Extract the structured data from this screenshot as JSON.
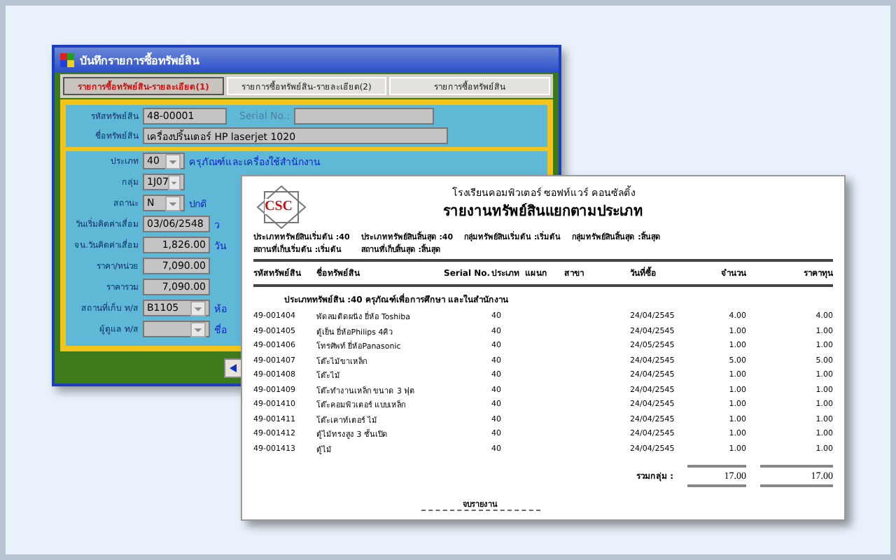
{
  "form": {
    "title": "บันทึกรายการซื้อทรัพย์สิน",
    "tabs": [
      {
        "label": "รายการซื้อทรัพย์สิน-รายละเอียด(1)",
        "selected": true
      },
      {
        "label": "รายการซื้อทรัพย์สิน-รายละเอียด(2)",
        "selected": false
      },
      {
        "label": "รายการซื้อทรัพย์สิน",
        "selected": false
      }
    ],
    "asset_code": {
      "label": "รหัสทรัพย์สิน",
      "value": "48-00001"
    },
    "serial": {
      "label": "Serial No.:"
    },
    "asset_name": {
      "label": "ชื่อทรัพย์สิน",
      "value": "เครื่องปริ้นเตอร์  HP laserjet  1020"
    },
    "fields": [
      {
        "kind": "combo",
        "label": "ประเภท",
        "value": "40",
        "note": "ครุภัณฑ์และเครื่องใช้สำนักงาน"
      },
      {
        "kind": "combo",
        "label": "กลุ่ม",
        "value": "1J07"
      },
      {
        "kind": "combo",
        "label": "สถานะ",
        "value": "N",
        "note": "ปกติ"
      },
      {
        "kind": "text",
        "label": "วันเริ่มคิดค่าเสื่อม",
        "value": "03/06/2548",
        "note": "ว"
      },
      {
        "kind": "number",
        "label": "จน.วันคิดค่าเสื่อม",
        "value": "1,826.00",
        "note": "วัน"
      },
      {
        "kind": "number",
        "label": "ราคา/หน่วย",
        "value": "7,090.00"
      },
      {
        "kind": "number",
        "label": "ราคารวม",
        "value": "7,090.00"
      },
      {
        "kind": "combo",
        "label": "สถานที่เก็บ ท/ส",
        "value": "B1105",
        "note": "ห้อ"
      },
      {
        "kind": "combo",
        "label": "ผู้ดูแล ท/ส",
        "note": "ชื่อ"
      }
    ]
  },
  "report": {
    "organization": "โรงเรียนคอมพิวเตอร์ ซอฟท์แวร์ คอนซัลติ้ง",
    "logo": "CSC",
    "title": "รายงานทรัพย์สินแยกตามประเภท",
    "filters": [
      "ประเภททรัพย์สินเริ่มต้น :40",
      "ประเภททรัพย์สินสิ้นสุด :40",
      "กลุ่มทรัพย์สินเริ่มต้น :เริ่มต้น",
      "กลุ่มทรัพย์สินสิ้นสุด :สิ้นสุด",
      "สถานที่เก็บเริ่มต้น :เริ่มต้น",
      "สถานที่เก็บสิ้นสุด :สิ้นสุด"
    ],
    "columns": [
      "รหัสทรัพย์สิน",
      "ชื่อทรัพย์สิน",
      "Serial No.",
      "ประเภท",
      "แผนก",
      "สาขา",
      "วันที่ซื้อ",
      "จำนวน",
      "ราคาทุน"
    ],
    "group": "ประเภททรัพย์สิน :40 ครุภัณฑ์เพื่อการศึกษา และในสำนักงาน",
    "rows": [
      [
        "49-001404",
        "พัดลมติดผนัง ยี่ห้อ Toshiba",
        "",
        "40",
        "",
        "",
        "24/04/2545",
        "4.00",
        "4.00"
      ],
      [
        "49-001405",
        "ตู้เย็น ยี่ห้อPhilips 4คิว",
        "",
        "40",
        "",
        "",
        "24/04/2545",
        "1.00",
        "1.00"
      ],
      [
        "49-001406",
        "โทรศัพท์ ยี่ห้อPanasonic",
        "",
        "40",
        "",
        "",
        "24/05/2545",
        "1.00",
        "1.00"
      ],
      [
        "49-001407",
        "โต๊ะไม้ขาเหล็ก",
        "",
        "40",
        "",
        "",
        "24/04/2545",
        "5.00",
        "5.00"
      ],
      [
        "49-001408",
        "โต๊ะไม้",
        "",
        "40",
        "",
        "",
        "24/04/2545",
        "1.00",
        "1.00"
      ],
      [
        "49-001409",
        "โต๊ะทำงานเหล็ก ขนาด 3 ฟุต",
        "",
        "40",
        "",
        "",
        "24/04/2545",
        "1.00",
        "1.00"
      ],
      [
        "49-001410",
        "โต๊ะคอมพิวเตอร์ แบบเหล็ก",
        "",
        "40",
        "",
        "",
        "24/04/2545",
        "1.00",
        "1.00"
      ],
      [
        "49-001411",
        "โต๊ะเคาท์เตอร์ ไม้",
        "",
        "40",
        "",
        "",
        "24/04/2545",
        "1.00",
        "1.00"
      ],
      [
        "49-001412",
        "ตู้ไม้ทรงสูง 3 ชั้นเปิด",
        "",
        "40",
        "",
        "",
        "24/04/2545",
        "1.00",
        "1.00"
      ],
      [
        "49-001413",
        "ตู้ไม้",
        "",
        "40",
        "",
        "",
        "24/04/2545",
        "1.00",
        "1.00"
      ]
    ],
    "total_label": "รวมกลุ่ม :",
    "totals": [
      "17.00",
      "17.00"
    ],
    "footer": "จบรายงาน"
  }
}
